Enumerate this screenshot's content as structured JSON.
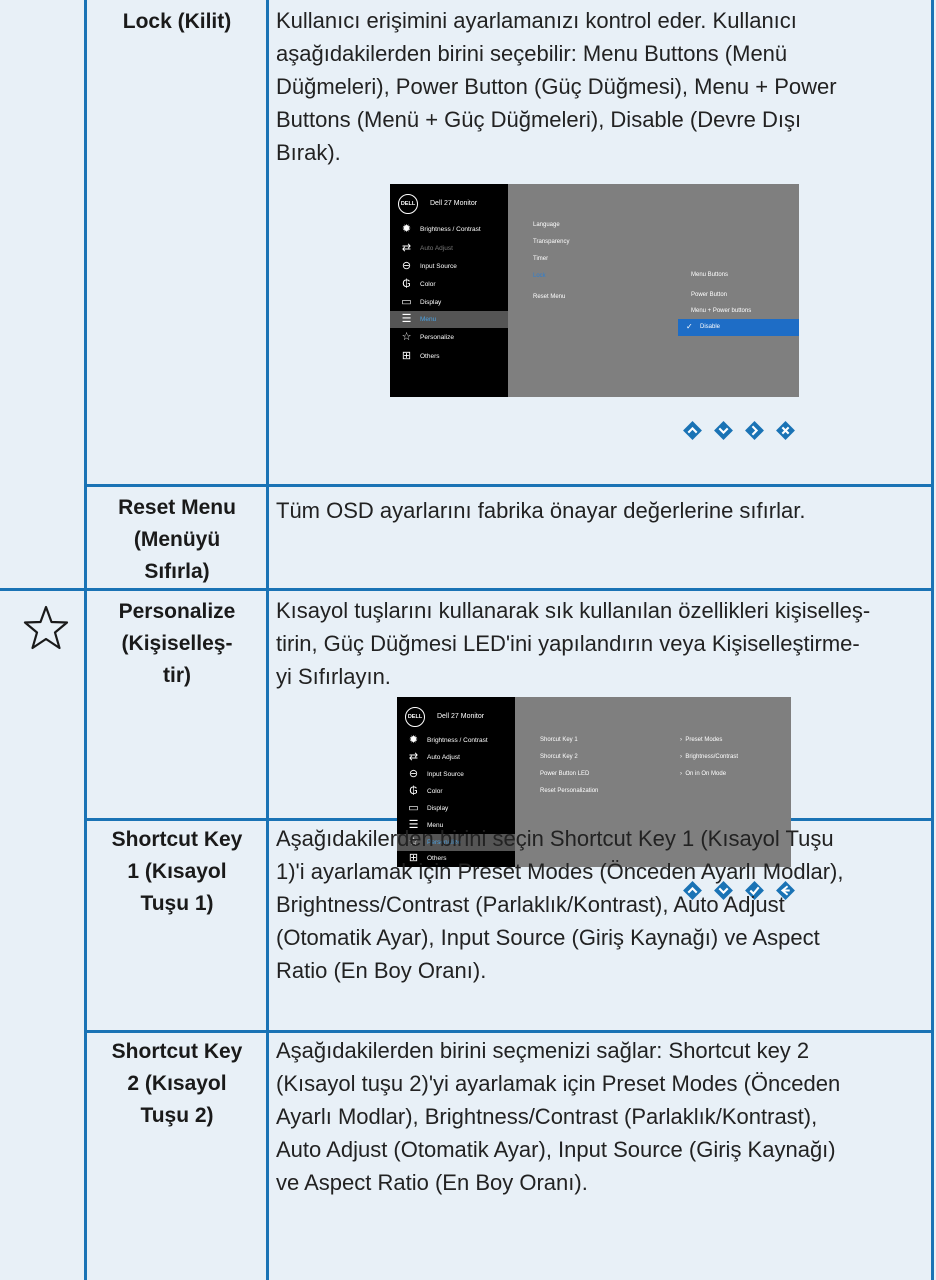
{
  "rows": {
    "lock": {
      "label": "Lock (Kilit)",
      "desc": [
        "Kullanıcı erişimini ayarlamanızı kontrol eder. Kullanıcı",
        "aşağıdakilerden birini seçebilir: Menu Buttons (Menü",
        "Düğmeleri), Power Button (Güç Düğmesi), Menu + Power",
        "Buttons (Menü + Güç Düğmeleri), Disable (Devre Dışı",
        "Bırak)."
      ]
    },
    "reset": {
      "label": [
        "Reset Menu",
        "(Menüyü",
        "Sıfırla)"
      ],
      "desc": "Tüm OSD ayarlarını fabrika önayar değerlerine sıfırlar."
    },
    "personalize": {
      "icon": "star-icon",
      "label": [
        "Personalize",
        "(Kişiselleş-",
        "tir)"
      ],
      "desc": [
        "Kısayol tuşlarını kullanarak sık kullanılan özellikleri kişiselleş-",
        "tirin, Güç Düğmesi LED'ini yapılandırın veya Kişiselleştirme-",
        "yi Sıfırlayın."
      ]
    },
    "shortcut1": {
      "label": [
        "Shortcut Key",
        "1 (Kısayol",
        "Tuşu 1)"
      ],
      "desc": [
        "Aşağıdakilerden birini seçin Shortcut Key 1 (Kısayol Tuşu",
        "1)'i ayarlamak için Preset Modes (Önceden Ayarlı Modlar),",
        "Brightness/Contrast (Parlaklık/Kontrast), Auto Adjust",
        "(Otomatik Ayar), Input Source (Giriş Kaynağı) ve Aspect",
        "Ratio (En Boy Oranı)."
      ]
    },
    "shortcut2": {
      "label": [
        "Shortcut Key",
        "2 (Kısayol",
        "Tuşu 2)"
      ],
      "desc": [
        "Aşağıdakilerden birini seçmenizi sağlar: Shortcut key 2",
        "(Kısayol tuşu 2)'yi ayarlamak için Preset Modes (Önceden",
        "Ayarlı Modlar), Brightness/Contrast (Parlaklık/Kontrast),",
        "Auto Adjust (Otomatik Ayar), Input Source (Giriş Kaynağı)",
        "ve Aspect Ratio (En Boy Oranı)."
      ]
    }
  },
  "osd1": {
    "logo": "DELL",
    "title": "Dell 27 Monitor",
    "menu": [
      "Brightness / Contrast",
      "Auto Adjust",
      "Input Source",
      "Color",
      "Display",
      "Menu",
      "Personalize",
      "Others"
    ],
    "sub": [
      "Language",
      "Transparency",
      "Timer",
      "Lock",
      "Reset Menu"
    ],
    "options": [
      "Menu Buttons",
      "Power Button",
      "Menu + Power buttons",
      "Disable"
    ]
  },
  "osd2": {
    "logo": "DELL",
    "title": "Dell 27 Monitor",
    "menu": [
      "Brightness / Contrast",
      "Auto Adjust",
      "Input Source",
      "Color",
      "Display",
      "Menu",
      "Personalize",
      "Others"
    ],
    "sub": [
      "Shorcut Key 1",
      "Shorcut Key 2",
      "Power Button LED",
      "Reset Personalization"
    ],
    "values": [
      "Preset Modes",
      "Brightness/Contrast",
      "On in On Mode"
    ]
  },
  "colors": {
    "border": "#1a73b5",
    "background": "#e8f0f7",
    "osd_highlight": "#1e6dc6"
  }
}
